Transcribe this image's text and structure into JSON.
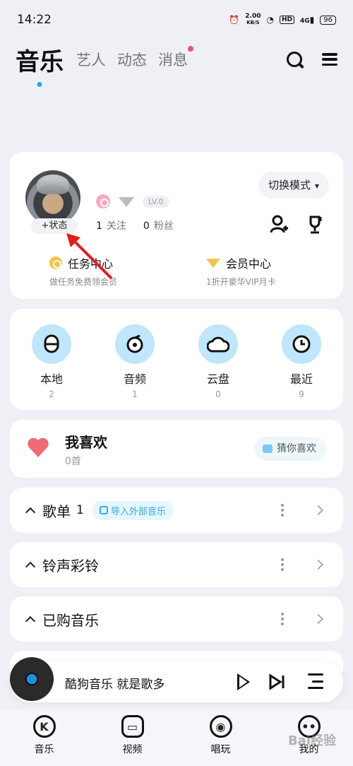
{
  "status_bar": {
    "time": "14:22",
    "net_speed": "2.00",
    "net_unit": "KB/S",
    "hd": "HD",
    "net_type": "4G",
    "battery": "96"
  },
  "top_nav": {
    "tabs": [
      {
        "label": "音乐",
        "active": true
      },
      {
        "label": "艺人"
      },
      {
        "label": "动态"
      },
      {
        "label": "消息",
        "has_dot": true
      }
    ],
    "icons": [
      "search-icon",
      "menu-icon"
    ]
  },
  "profile": {
    "status_label": "+状态",
    "level": "LV.0",
    "following_count": "1",
    "following_label": "关注",
    "fans_count": "0",
    "fans_label": "粉丝",
    "mode_button": "切换模式",
    "task_center": {
      "title": "任务中心",
      "subtitle": "做任务免费领会员"
    },
    "vip_center": {
      "title": "会员中心",
      "subtitle": "1折开豪华VIP月卡"
    }
  },
  "quick_access": [
    {
      "label": "本地",
      "count": "2",
      "icon": "local-icon"
    },
    {
      "label": "音频",
      "count": "1",
      "icon": "audio-icon"
    },
    {
      "label": "云盘",
      "count": "0",
      "icon": "cloud-icon"
    },
    {
      "label": "最近",
      "count": "9",
      "icon": "clock-icon"
    }
  ],
  "favorites": {
    "title": "我喜欢",
    "count": "0首",
    "guess_button": "猜你喜欢"
  },
  "sections": [
    {
      "title": "歌单",
      "count": "1",
      "tag": "导入外部音乐"
    },
    {
      "title": "铃声彩铃"
    },
    {
      "title": "已购音乐"
    }
  ],
  "player": {
    "title": "酷狗音乐  就是歌多"
  },
  "bottom_nav": [
    {
      "label": "音乐",
      "icon": "k-logo-icon"
    },
    {
      "label": "视频",
      "icon": "video-icon"
    },
    {
      "label": "唱玩",
      "icon": "mic-icon"
    },
    {
      "label": "我的",
      "icon": "profile-face-icon"
    }
  ],
  "watermark": "Bai经验",
  "colors": {
    "accent": "#2aa3f5",
    "quick_icon_bg": "#bfe6fb",
    "heart": "#f06b7a",
    "arrow": "#e02020"
  }
}
